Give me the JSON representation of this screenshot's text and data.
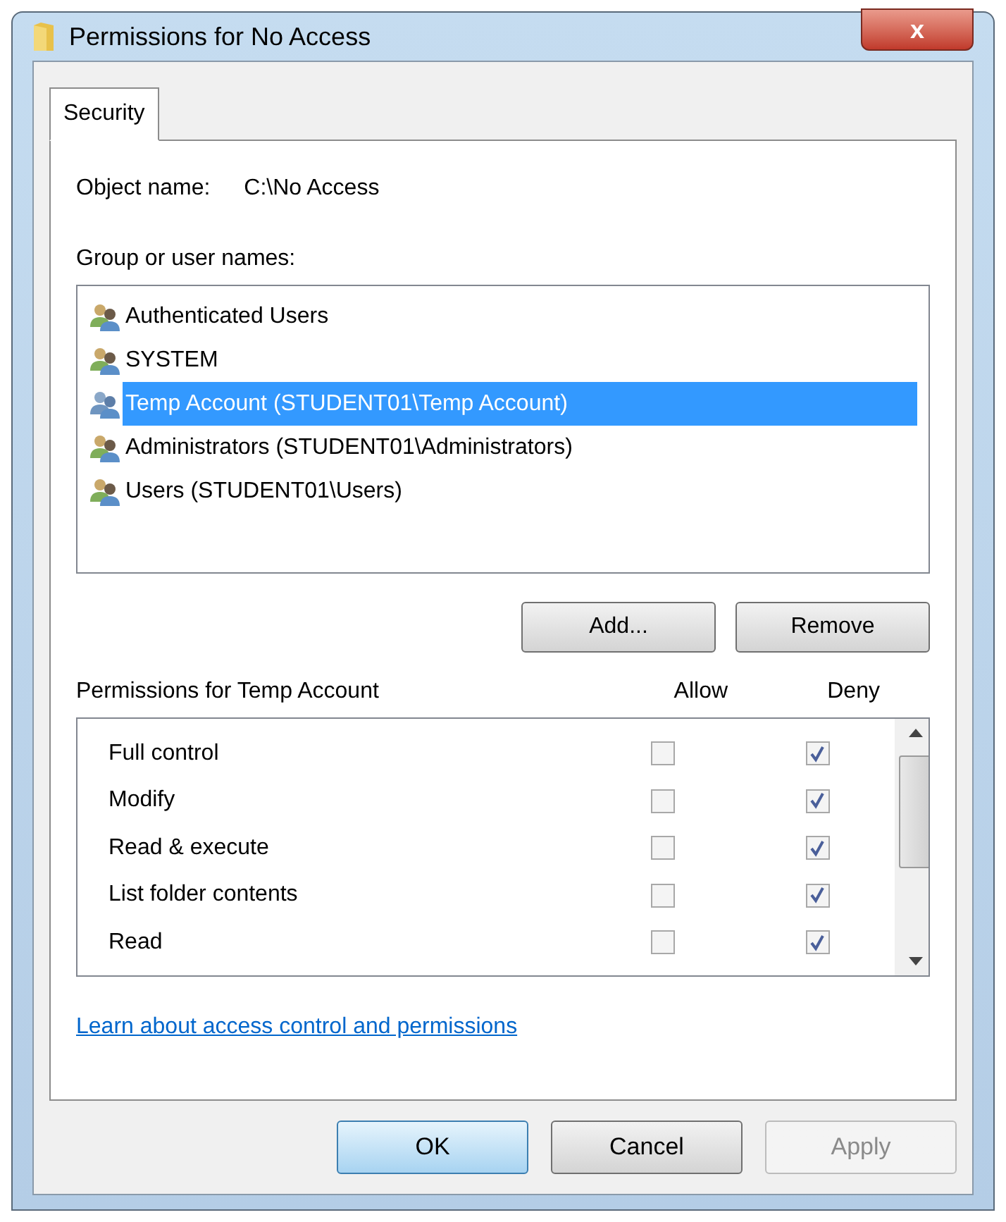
{
  "window": {
    "title": "Permissions for No Access",
    "close": "x"
  },
  "tabs": [
    {
      "label": "Security",
      "selected": true
    }
  ],
  "object_name": {
    "label": "Object name:",
    "value": "C:\\No Access"
  },
  "group_list": {
    "label": "Group or user names:",
    "items": [
      {
        "name": "Authenticated Users",
        "selected": false
      },
      {
        "name": "SYSTEM",
        "selected": false
      },
      {
        "name": "Temp Account (STUDENT01\\Temp Account)",
        "selected": true
      },
      {
        "name": "Administrators (STUDENT01\\Administrators)",
        "selected": false
      },
      {
        "name": "Users (STUDENT01\\Users)",
        "selected": false
      }
    ]
  },
  "list_buttons": [
    {
      "label": "Add..."
    },
    {
      "label": "Remove"
    }
  ],
  "permissions": {
    "label": "Permissions for Temp Account",
    "columns": [
      "Allow",
      "Deny"
    ],
    "rows": [
      {
        "name": "Full control",
        "allow": false,
        "deny": true
      },
      {
        "name": "Modify",
        "allow": false,
        "deny": true
      },
      {
        "name": "Read & execute",
        "allow": false,
        "deny": true
      },
      {
        "name": "List folder contents",
        "allow": false,
        "deny": true
      },
      {
        "name": "Read",
        "allow": false,
        "deny": true
      }
    ]
  },
  "link": "Learn about access control and permissions",
  "buttons": [
    {
      "label": "OK",
      "default": true,
      "disabled": false
    },
    {
      "label": "Cancel",
      "default": false,
      "disabled": false
    },
    {
      "label": "Apply",
      "default": false,
      "disabled": true
    }
  ]
}
